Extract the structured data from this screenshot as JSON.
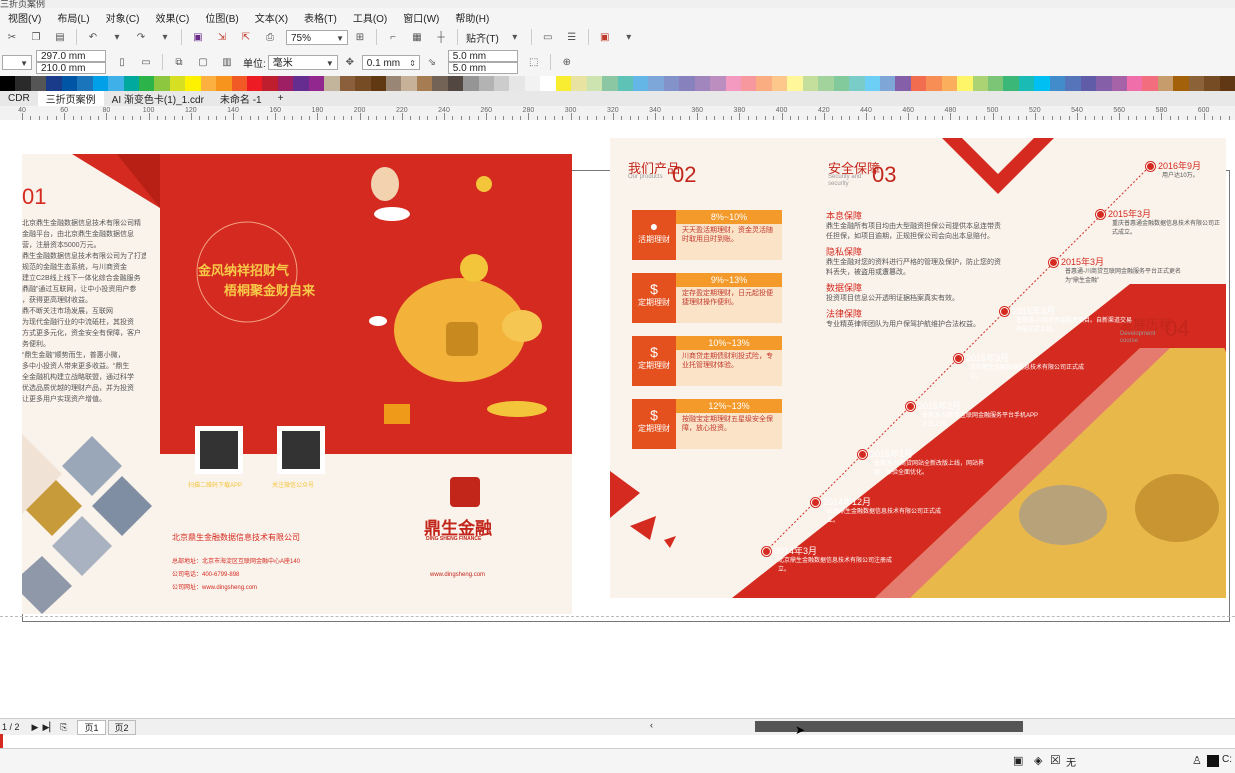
{
  "window": {
    "title": "三折页案例"
  },
  "menu": [
    "视图(V)",
    "布局(L)",
    "对象(C)",
    "效果(C)",
    "位图(B)",
    "文本(X)",
    "表格(T)",
    "工具(O)",
    "窗口(W)",
    "帮助(H)"
  ],
  "toolbar": {
    "zoom": "75%",
    "snap": "贴齐(T)"
  },
  "propbar": {
    "width": "297.0 mm",
    "height": "210.0 mm",
    "unit_label": "单位:",
    "unit": "毫米",
    "nudge": "0.1 mm",
    "dup_x": "5.0 mm",
    "dup_y": "5.0 mm"
  },
  "doc_tabs": [
    "CDR",
    "三折页案例",
    "AI 渐变色卡(1)_1.cdr",
    "未命名 -1"
  ],
  "ruler_labels": [
    "40",
    "60",
    "80",
    "100",
    "120",
    "140",
    "160",
    "180",
    "200",
    "220",
    "240",
    "260",
    "280",
    "300",
    "320",
    "340",
    "360",
    "380",
    "400",
    "420",
    "440",
    "460",
    "480",
    "500",
    "520",
    "540",
    "560",
    "580",
    "600"
  ],
  "pages": {
    "indicator": "1 / 2",
    "tabs": [
      "页1",
      "页2"
    ]
  },
  "palette": [
    "#000000",
    "#2a2a2a",
    "#555",
    "#1a3a8a",
    "#0055a5",
    "#1b75bb",
    "#00a0e9",
    "#3fb0e8",
    "#00a99d",
    "#2cb34a",
    "#8dc63f",
    "#d7df23",
    "#fff200",
    "#fbb040",
    "#f7941d",
    "#f15a24",
    "#ed1c24",
    "#be1e2d",
    "#9e1f63",
    "#662d91",
    "#92278f",
    "#c2b59b",
    "#8b5e3c",
    "#754c24",
    "#603913",
    "#998675",
    "#c7b299",
    "#a67c52",
    "#736357",
    "#534741",
    "#959595",
    "#b3b3b3",
    "#cccccc",
    "#e6e6e6",
    "#f2f2f2",
    "#ffffff",
    "#f9ed32",
    "#e9e3a1",
    "#cde3b0",
    "#8bc7a3",
    "#5ec2b7",
    "#63b6e5",
    "#7da7d9",
    "#8393ca",
    "#8781bd",
    "#a186be",
    "#bc8dbf",
    "#f49ac1",
    "#f6989d",
    "#f9ad81",
    "#fdc68a",
    "#fff799",
    "#c4df9b",
    "#a3d39c",
    "#82ca9c",
    "#7accc8",
    "#6dcff6",
    "#7ea7d8",
    "#8560a8",
    "#f26c4f",
    "#f68e56",
    "#fbaf5d",
    "#fff568",
    "#acd373",
    "#7cc576",
    "#3bb878",
    "#1abbb4",
    "#00bff3",
    "#438ccb",
    "#5574b9",
    "#605ca8",
    "#855fa8",
    "#a763a8",
    "#f06eaa",
    "#f26d7d",
    "#c69c6d",
    "#a36209",
    "#8c6239",
    "#754c24",
    "#603813"
  ],
  "left": {
    "panel_num": "01",
    "intro_lines": [
      "北京鼎生金融数据信息技术有限公司精",
      "金融平台，由北京鼎生金融数据信息",
      "营，注册资本5000万元。",
      "鼎生金融数据信息技术有限公司为了打造专业",
      "规范的金融生态系统，与川商资金",
      "建立C2B线上线下一体化综合金融服务",
      "鼎融”通过互联网，让中小投资用户参",
      "，获得更高理财收益。",
      "鼎不断关注市场发展，互联网",
      "为现代金融行业的中流砥柱，其投资",
      "方式更多元化，资金安全有保障，客户",
      "务便利。",
      "“鼎生金融”顺势而生，普惠小微，",
      "多中小投资人带来更多收益。“鼎生",
      "全金融机构建立战略联盟，通过科学",
      "优选品质优越的理财产品，并为投资",
      "让更多用户实现资产增值。"
    ],
    "slogan1": "金风纳祥招财气",
    "slogan2": "梧桐聚金财自来",
    "qr1_caption": "扫描二维码下载APP",
    "qr2_caption": "关注微信公众号",
    "company": "北京鼎生金融数据信息技术有限公司",
    "address": "总部地址：北京市海淀区互联网金融中心A座140",
    "phone": "公司电话：400-6799-898",
    "website_line": "公司网址：www.dingsheng.com",
    "brand_cn": "鼎生金融",
    "brand_en": "DING SHENG FINANCE",
    "brand_url": "www.dingsheng.com"
  },
  "right": {
    "products_title": "我们产品",
    "products_sub": "Our products",
    "products_num": "02",
    "products": [
      {
        "rate": "8%~10%",
        "name": "活期理财",
        "desc": "天天盈活期理财，资金灵活随时取用且时到账。"
      },
      {
        "rate": "9%~13%",
        "name": "定期理财",
        "desc": "定存盈定期理财，日元起投便捷理财操作便利。"
      },
      {
        "rate": "10%~13%",
        "name": "定期理财",
        "desc": "川商贷走期债财利投式险，专业托管理财体验。"
      },
      {
        "rate": "12%~13%",
        "name": "定期理财",
        "desc": "按融宝定期理财五星级安全保障，放心投资。"
      }
    ],
    "security_title": "安全保障",
    "security_sub": "Security and security",
    "security_num": "03",
    "security_items": [
      {
        "head": "本息保障",
        "body": "鼎生金融所有项目均由大型融资担保公司提供本息连带责任担保，如项目逾期，正规担保公司会向出本息赔付。"
      },
      {
        "head": "隐私保障",
        "body": "鼎生金融对您的资料进行严格的管理及保护，防止您的资料丢失，被盗用或遭篡改。"
      },
      {
        "head": "数据保障",
        "body": "投资项目信息公开透明证据档案真实有效。"
      },
      {
        "head": "法律保障",
        "body": "专业精英律师团队为用户保驾护航维护合法权益。"
      }
    ],
    "history_title": "发展历程",
    "history_sub": "Development course",
    "history_num": "04",
    "timeline": [
      {
        "year": "2016年9月",
        "text": "用户达10万。"
      },
      {
        "year": "2015年3月",
        "text": "重庆普惠通金融数据信息技术有限公司正式成立。"
      },
      {
        "year": "2015年3月",
        "text": "普惠通-川商贷互联网金融服务平台正式更名为“鼎生金融”"
      },
      {
        "year": "2015年3月",
        "text": "普惠通-川商贷资金投资项目。自新渠道交易功能正式上线。"
      },
      {
        "year": "2015年3月",
        "text": "沈阳鼎生金融数据信息技术有限公司正式成立。"
      },
      {
        "year": "2015年2月",
        "text": "普惠通-川商贷互联网金融服务平台手机APP正式上线。"
      },
      {
        "year": "2015年1月",
        "text": "普惠通-川商贷网站全新改版上线，网站界面，体验全面优化。"
      },
      {
        "year": "2014年12月",
        "text": "云南鼎生金融数据信息技术有限公司正式成立。"
      },
      {
        "year": "2014年3月",
        "text": "北京鼎生金融数据信息技术有限公司注册成立。"
      }
    ]
  },
  "status": {
    "fill_none": "无",
    "color_code": "C:"
  }
}
